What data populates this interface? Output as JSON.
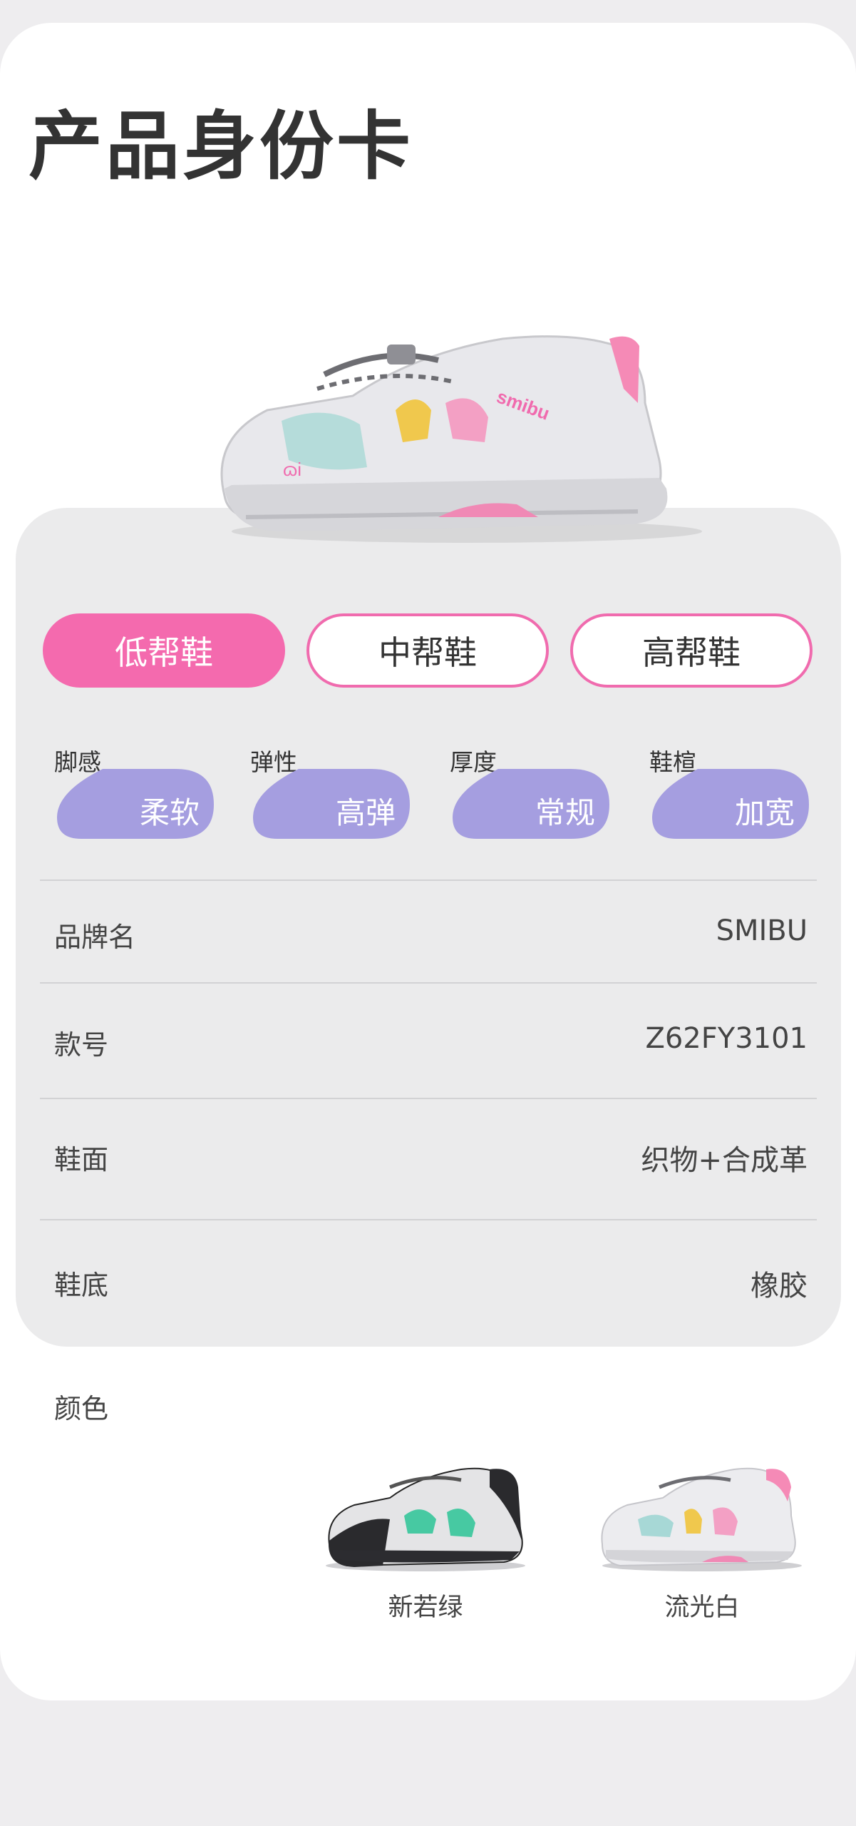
{
  "page_title": "产品身份卡",
  "tabs": [
    {
      "label": "低帮鞋",
      "active": true
    },
    {
      "label": "中帮鞋",
      "active": false
    },
    {
      "label": "高帮鞋",
      "active": false
    }
  ],
  "attributes": [
    {
      "label": "脚感",
      "value": "柔软"
    },
    {
      "label": "弹性",
      "value": "高弹"
    },
    {
      "label": "厚度",
      "value": "常规"
    },
    {
      "label": "鞋楦",
      "value": "加宽"
    }
  ],
  "specs": [
    {
      "label": "品牌名",
      "value": "SMIBU"
    },
    {
      "label": "款号",
      "value": "Z62FY3101"
    },
    {
      "label": "鞋面",
      "value": "织物+合成革"
    },
    {
      "label": "鞋底",
      "value": "橡胶"
    }
  ],
  "colors": {
    "title": "颜色",
    "variants": [
      {
        "name": "新若绿"
      },
      {
        "name": "流光白"
      }
    ]
  },
  "hero": {
    "brand_text": "smibu"
  },
  "theme": {
    "accent": "#f46aae",
    "pill": "#a59ee0",
    "panel": "#ebebec"
  }
}
